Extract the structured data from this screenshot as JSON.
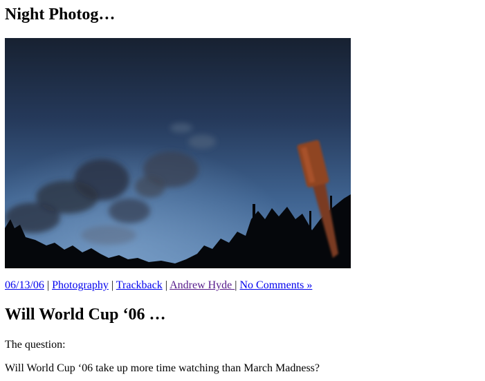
{
  "posts": [
    {
      "title": "Night Photog…",
      "meta": {
        "date": "06/13/06",
        "category": "Photography",
        "trackback": "Trackback",
        "author": "Andrew Hyde ",
        "comments": "No Comments »",
        "separator": " | "
      }
    },
    {
      "title": "Will World Cup ‘06 …",
      "paragraphs": [
        "The question:",
        "Will World Cup ‘06 take up more time watching than March Madness?"
      ]
    }
  ]
}
